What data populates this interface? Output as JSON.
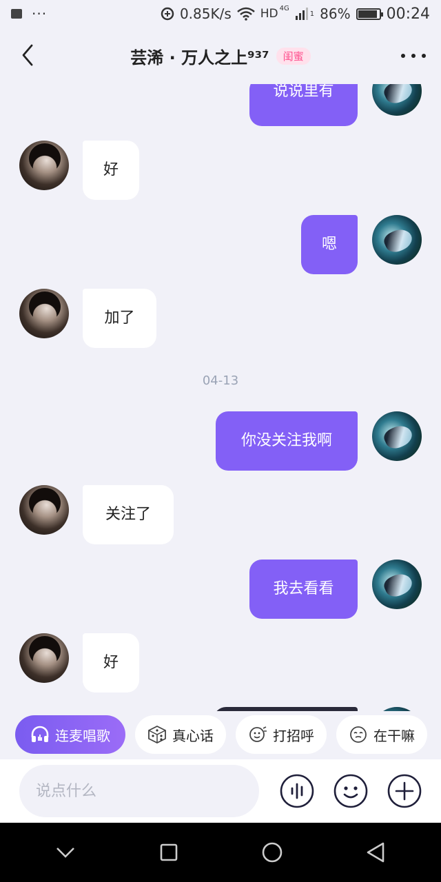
{
  "status_bar": {
    "network_speed": "0.85K/s",
    "network_type": "HD",
    "cell_label": "4G",
    "battery": "86%",
    "battery_level": 0.86,
    "time": "00:24",
    "dots": "···",
    "sim_slot": "1"
  },
  "header": {
    "title": "芸浠 · 万人之上⁹³⁷",
    "tag": "闺蜜"
  },
  "messages": [
    {
      "side": "out",
      "text": "说说里有"
    },
    {
      "side": "in",
      "text": "好"
    },
    {
      "side": "out",
      "text": "嗯"
    },
    {
      "side": "in",
      "text": "加了"
    },
    {
      "side": "out",
      "text": "你没关注我啊"
    },
    {
      "side": "in",
      "text": "关注了"
    },
    {
      "side": "out",
      "text": "我去看看"
    },
    {
      "side": "in",
      "text": "好"
    }
  ],
  "date_divider": "04-13",
  "quick_actions": [
    {
      "label": "连麦唱歌",
      "icon": "headphones-icon"
    },
    {
      "label": "真心话",
      "icon": "dice-icon"
    },
    {
      "label": "打招呼",
      "icon": "wave-icon"
    },
    {
      "label": "在干嘛",
      "icon": "face-icon"
    }
  ],
  "input": {
    "placeholder": "说点什么"
  },
  "colors": {
    "accent": "#8360f6",
    "background": "#f1f1f8",
    "tag_text": "#ff4d8c",
    "tag_bg": "#ffe1ec"
  }
}
